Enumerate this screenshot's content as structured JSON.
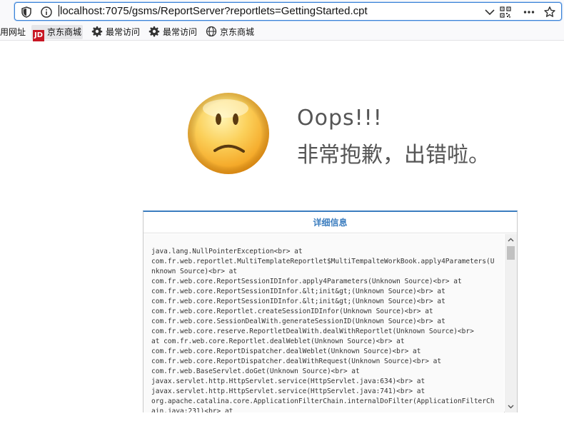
{
  "browser": {
    "url": "localhost:7075/gsms/ReportServer?reportlets=GettingStarted.cpt"
  },
  "bookmarks": [
    {
      "label": "用网址",
      "icon": "none"
    },
    {
      "label": "京东商城",
      "icon": "jd-logo-icon",
      "logo_text": "JD"
    },
    {
      "label": "最常访问",
      "icon": "gear-icon"
    },
    {
      "label": "最常访问",
      "icon": "gear-icon"
    },
    {
      "label": "京东商城",
      "icon": "globe-icon"
    }
  ],
  "error": {
    "title": "Oops!!!",
    "subtitle": "非常抱歉，出错啦。"
  },
  "detail": {
    "header": "详细信息",
    "trace": "java.lang.NullPointerException<br> at\ncom.fr.web.reportlet.MultiTemplateReportlet$MultiTempalteWorkBook.apply4Parameters(Unknown Source)<br> at\ncom.fr.web.core.ReportSessionIDInfor.apply4Parameters(Unknown Source)<br> at\ncom.fr.web.core.ReportSessionIDInfor.&lt;init&gt;(Unknown Source)<br> at\ncom.fr.web.core.ReportSessionIDInfor.&lt;init&gt;(Unknown Source)<br> at\ncom.fr.web.core.Reportlet.createSessionIDInfor(Unknown Source)<br> at\ncom.fr.web.core.SessionDealWith.generateSessionID(Unknown Source)<br> at\ncom.fr.web.core.reserve.ReportletDealWith.dealWithReportlet(Unknown Source)<br>\nat com.fr.web.core.Reportlet.dealWeblet(Unknown Source)<br> at\ncom.fr.web.core.ReportDispatcher.dealWeblet(Unknown Source)<br> at\ncom.fr.web.core.ReportDispatcher.dealWithRequest(Unknown Source)<br> at\ncom.fr.web.BaseServlet.doGet(Unknown Source)<br> at\njavax.servlet.http.HttpServlet.service(HttpServlet.java:634)<br> at\njavax.servlet.http.HttpServlet.service(HttpServlet.java:741)<br> at\norg.apache.catalina.core.ApplicationFilterChain.internalDoFilter(ApplicationFilterChain.java:231)<br> at"
  },
  "colors": {
    "accent": "#3b7dbf",
    "face": "#f7b52c"
  }
}
